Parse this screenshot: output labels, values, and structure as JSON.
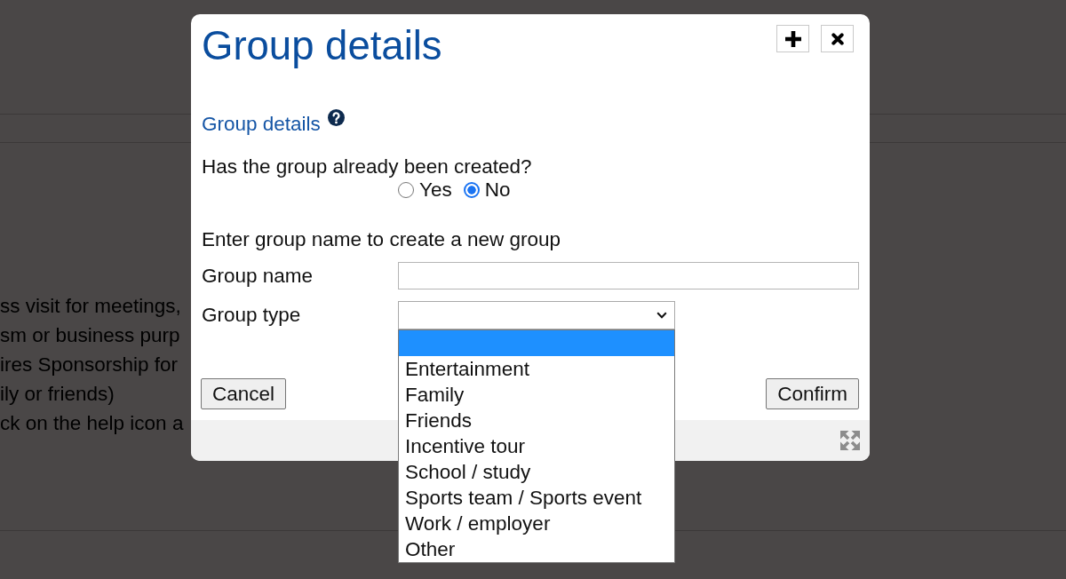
{
  "background_page": {
    "text_lines": [
      "ss visit for meetings,",
      "sm or business purp",
      "ires Sponsorship for",
      "ily or friends)",
      "ck on the help icon a"
    ]
  },
  "dialog": {
    "title": "Group details",
    "section_heading": "Group details",
    "question": {
      "label": "Has the group already been created?",
      "options": [
        {
          "label": "Yes",
          "selected": false
        },
        {
          "label": "No",
          "selected": true
        }
      ]
    },
    "instruction": "Enter group name to create a new group",
    "fields": [
      {
        "kind": "text",
        "label": "Group name"
      },
      {
        "kind": "select",
        "label": "Group type",
        "expanded": true,
        "options": [
          {
            "selected": true
          },
          {
            "label": "Entertainment",
            "selected": false
          },
          {
            "label": "Family",
            "selected": false
          },
          {
            "label": "Friends",
            "selected": false
          },
          {
            "label": "Incentive tour",
            "selected": false
          },
          {
            "label": "School / study",
            "selected": false
          },
          {
            "label": "Sports team / Sports event",
            "selected": false
          },
          {
            "label": "Work / employer",
            "selected": false
          },
          {
            "label": "Other",
            "selected": false
          }
        ]
      }
    ],
    "buttons": [
      {
        "label": "Cancel"
      },
      {
        "label": "Confirm"
      }
    ]
  }
}
